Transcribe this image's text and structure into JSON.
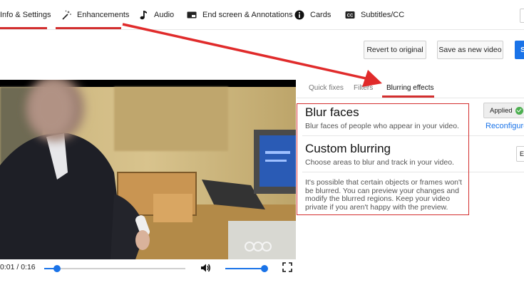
{
  "top_tabs": {
    "info": "Info & Settings",
    "enhancements": "Enhancements",
    "audio": "Audio",
    "end_screen": "End screen & Annotations",
    "cards": "Cards",
    "subtitles": "Subtitles/CC"
  },
  "toolbar": {
    "revert_label": "Revert to original",
    "save_new_label": "Save as new video",
    "save_label": "S"
  },
  "player": {
    "time": "0:01 / 0:16",
    "progress_fraction": 0.09,
    "volume_fraction": 0.95
  },
  "sub_tabs": {
    "quick_fixes": "Quick fixes",
    "filters": "Filters",
    "blurring": "Blurring effects"
  },
  "blur_faces": {
    "title": "Blur faces",
    "description": "Blur faces of people who appear in your video.",
    "status": "Applied",
    "action": "Reconfigure"
  },
  "custom_blurring": {
    "title": "Custom blurring",
    "description": "Choose areas to blur and track in your video.",
    "action": "E"
  },
  "note": "It's possible that certain objects or frames won't be blurred. You can preview your changes and modify the blurred regions. Keep your video private if you aren't happy with the preview.",
  "colors": {
    "accent": "#1a73e8",
    "annotation_red": "#d32f2f",
    "applied_check": "#4caf50"
  }
}
